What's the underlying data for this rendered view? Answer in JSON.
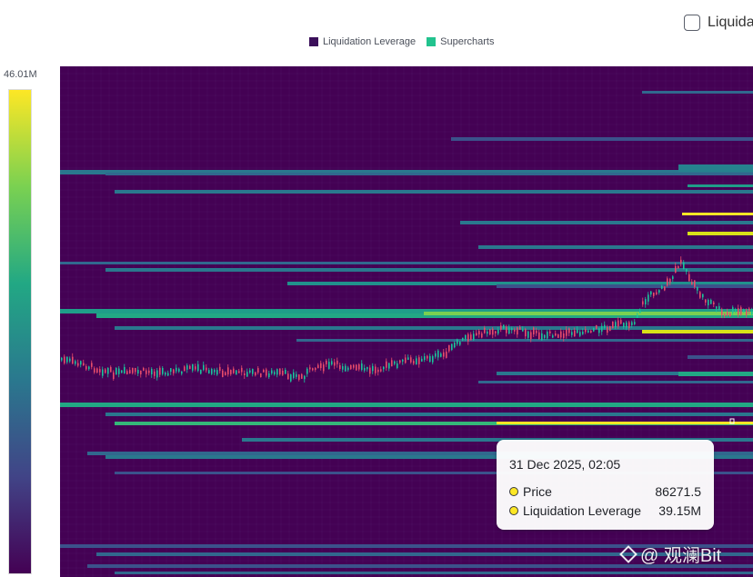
{
  "colors": {
    "liquidation": "#3b0f5a",
    "supercharts": "#22c38e",
    "background": "#440154",
    "candle_up": "#19c59b",
    "candle_down": "#e74c6a",
    "scale_stops": [
      "#fde725",
      "#7ad151",
      "#22a884",
      "#2a788e",
      "#414487",
      "#440154"
    ]
  },
  "legend": {
    "items": [
      {
        "label": "Liquidation Leverage",
        "color": "#3b0f5a"
      },
      {
        "label": "Supercharts",
        "color": "#22c38e"
      }
    ]
  },
  "toggle": {
    "label": "Liquida"
  },
  "scale": {
    "max_label": "46.01M"
  },
  "tooltip": {
    "date": "31 Dec 2025, 02:05",
    "rows": [
      {
        "label": "Price",
        "value": "86271.5"
      },
      {
        "label": "Liquidation Leverage",
        "value": "39.15M"
      }
    ]
  },
  "watermark": {
    "text": "@ 观澜Bit",
    "icon": "binance-diamond-icon"
  },
  "chart_data": {
    "type": "heatmap",
    "title": "",
    "xlabel": "",
    "ylabel": "",
    "value_max_label": "46.01M",
    "series": [
      {
        "name": "Liquidation Leverage",
        "type": "heatmap"
      },
      {
        "name": "Supercharts",
        "type": "candlestick"
      }
    ],
    "highlighted_point": {
      "time": "31 Dec 2025, 02:05",
      "price": 86271.5,
      "liquidation_leverage": "39.15M"
    }
  }
}
